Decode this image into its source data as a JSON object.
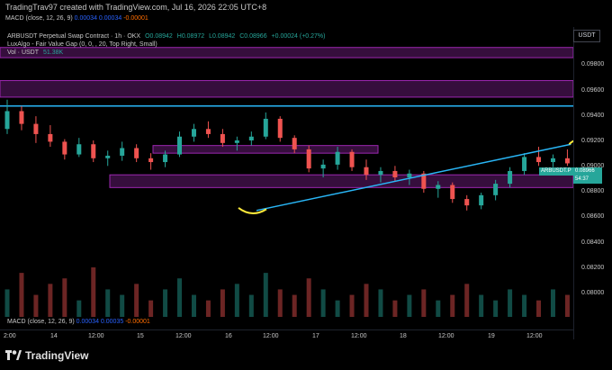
{
  "header": {
    "credit": "TradingTrav97 created with TradingView.com, Jul 16, 2026 22:05 UTC+8"
  },
  "macd_top": {
    "label": "MACD (close, 12, 26, 9)",
    "v1": "0.00034",
    "v2": "0.00034",
    "v3": "-0.00001"
  },
  "legend": {
    "symbol": "ARBUSDT Perpetual Swap Contract · 1h · OKX",
    "open": "O0.08942",
    "high": "H0.08972",
    "low": "L0.08942",
    "close": "C0.08966",
    "change": "+0.00024 (+0.27%)",
    "indicator": "LuxAlgo - Fair Value Gap (0, 0, , 20, Top Right, Small)",
    "vol_label": "Vol · USDT",
    "vol_value": "51.38K"
  },
  "price_axis": {
    "currency": "USDT",
    "labels": [
      "0.09800",
      "0.09600",
      "0.09400",
      "0.09200",
      "0.09000",
      "0.08800",
      "0.08600",
      "0.08400",
      "0.08200",
      "0.08000"
    ],
    "symbol_tag": "ARBUSDT.P",
    "current_price": "0.08966",
    "countdown": "54:37"
  },
  "macd_bottom": {
    "label": "MACD (close, 12, 26, 9)",
    "v1": "0.00034",
    "v2": "0.00035",
    "v3": "-0.00001"
  },
  "time_axis": {
    "labels": [
      "2:00",
      "14",
      "12:00",
      "15",
      "12:00",
      "16",
      "12:00",
      "17",
      "12:00",
      "18",
      "12:00",
      "19",
      "12:00"
    ]
  },
  "footer": {
    "brand": "TradingView"
  },
  "colors": {
    "up": "#26a69a",
    "down": "#ef5350",
    "fvg_purple": "#9c27b0",
    "line_blue": "#29b6f6",
    "highlight_yellow": "#ffeb3b"
  },
  "chart_data": {
    "type": "candlestick",
    "symbol": "ARBUSDT.P",
    "timeframe": "1h",
    "candles": [
      {
        "o": 0.0922,
        "h": 0.0945,
        "l": 0.0918,
        "c": 0.0936
      },
      {
        "o": 0.0936,
        "h": 0.094,
        "l": 0.0921,
        "c": 0.0926
      },
      {
        "o": 0.0926,
        "h": 0.0932,
        "l": 0.0911,
        "c": 0.0918
      },
      {
        "o": 0.0918,
        "h": 0.0925,
        "l": 0.0908,
        "c": 0.0912
      },
      {
        "o": 0.0912,
        "h": 0.0914,
        "l": 0.0898,
        "c": 0.0902
      },
      {
        "o": 0.0902,
        "h": 0.0915,
        "l": 0.09,
        "c": 0.091
      },
      {
        "o": 0.091,
        "h": 0.0913,
        "l": 0.0896,
        "c": 0.0899
      },
      {
        "o": 0.0899,
        "h": 0.0905,
        "l": 0.0893,
        "c": 0.0901
      },
      {
        "o": 0.0901,
        "h": 0.0912,
        "l": 0.0897,
        "c": 0.0907
      },
      {
        "o": 0.0907,
        "h": 0.091,
        "l": 0.0896,
        "c": 0.0899
      },
      {
        "o": 0.0899,
        "h": 0.0903,
        "l": 0.089,
        "c": 0.0896
      },
      {
        "o": 0.0896,
        "h": 0.0905,
        "l": 0.0892,
        "c": 0.0902
      },
      {
        "o": 0.0902,
        "h": 0.092,
        "l": 0.09,
        "c": 0.0916
      },
      {
        "o": 0.0916,
        "h": 0.0926,
        "l": 0.0912,
        "c": 0.0922
      },
      {
        "o": 0.0922,
        "h": 0.0928,
        "l": 0.0915,
        "c": 0.0918
      },
      {
        "o": 0.0918,
        "h": 0.0922,
        "l": 0.0908,
        "c": 0.0911
      },
      {
        "o": 0.0911,
        "h": 0.0916,
        "l": 0.0905,
        "c": 0.0913
      },
      {
        "o": 0.0913,
        "h": 0.092,
        "l": 0.0909,
        "c": 0.0916
      },
      {
        "o": 0.0916,
        "h": 0.0935,
        "l": 0.0914,
        "c": 0.093
      },
      {
        "o": 0.093,
        "h": 0.0932,
        "l": 0.0912,
        "c": 0.0915
      },
      {
        "o": 0.0915,
        "h": 0.0917,
        "l": 0.0903,
        "c": 0.0906
      },
      {
        "o": 0.0906,
        "h": 0.0909,
        "l": 0.0888,
        "c": 0.0891
      },
      {
        "o": 0.0891,
        "h": 0.0898,
        "l": 0.0884,
        "c": 0.0894
      },
      {
        "o": 0.0894,
        "h": 0.0908,
        "l": 0.089,
        "c": 0.0904
      },
      {
        "o": 0.0904,
        "h": 0.0906,
        "l": 0.0889,
        "c": 0.0892
      },
      {
        "o": 0.0892,
        "h": 0.0898,
        "l": 0.0882,
        "c": 0.0886
      },
      {
        "o": 0.0886,
        "h": 0.0892,
        "l": 0.088,
        "c": 0.0889
      },
      {
        "o": 0.0889,
        "h": 0.0893,
        "l": 0.0881,
        "c": 0.0884
      },
      {
        "o": 0.0884,
        "h": 0.089,
        "l": 0.0878,
        "c": 0.0887
      },
      {
        "o": 0.0887,
        "h": 0.0889,
        "l": 0.0872,
        "c": 0.0875
      },
      {
        "o": 0.0875,
        "h": 0.0881,
        "l": 0.0868,
        "c": 0.0878
      },
      {
        "o": 0.0878,
        "h": 0.088,
        "l": 0.0864,
        "c": 0.0867
      },
      {
        "o": 0.0867,
        "h": 0.087,
        "l": 0.0858,
        "c": 0.0862
      },
      {
        "o": 0.0862,
        "h": 0.0872,
        "l": 0.0859,
        "c": 0.087
      },
      {
        "o": 0.087,
        "h": 0.0882,
        "l": 0.0866,
        "c": 0.0879
      },
      {
        "o": 0.0879,
        "h": 0.0892,
        "l": 0.0876,
        "c": 0.0889
      },
      {
        "o": 0.0889,
        "h": 0.0903,
        "l": 0.0886,
        "c": 0.09
      },
      {
        "o": 0.09,
        "h": 0.0908,
        "l": 0.0893,
        "c": 0.0896
      },
      {
        "o": 0.0896,
        "h": 0.0902,
        "l": 0.0892,
        "c": 0.0899
      },
      {
        "o": 0.0899,
        "h": 0.0906,
        "l": 0.0893,
        "c": 0.0895
      },
      {
        "o": 0.0894,
        "h": 0.0898,
        "l": 0.0891,
        "c": 0.0897
      }
    ],
    "volume": [
      5,
      8,
      4,
      6,
      7,
      3,
      9,
      5,
      4,
      6,
      3,
      5,
      7,
      4,
      3,
      5,
      6,
      4,
      8,
      5,
      4,
      7,
      5,
      3,
      4,
      6,
      5,
      3,
      4,
      5,
      3,
      4,
      6,
      4,
      3,
      5,
      4,
      3,
      5,
      4,
      3
    ],
    "fvg_zones": [
      {
        "top": 0.0986,
        "bottom": 0.0978
      },
      {
        "top": 0.096,
        "bottom": 0.0947
      },
      {
        "top": 0.0909,
        "bottom": 0.0903
      },
      {
        "top": 0.0886,
        "bottom": 0.0876
      }
    ],
    "horizontal_lines": [
      0.094
    ],
    "ylim": [
      0.079,
      0.0995
    ]
  }
}
